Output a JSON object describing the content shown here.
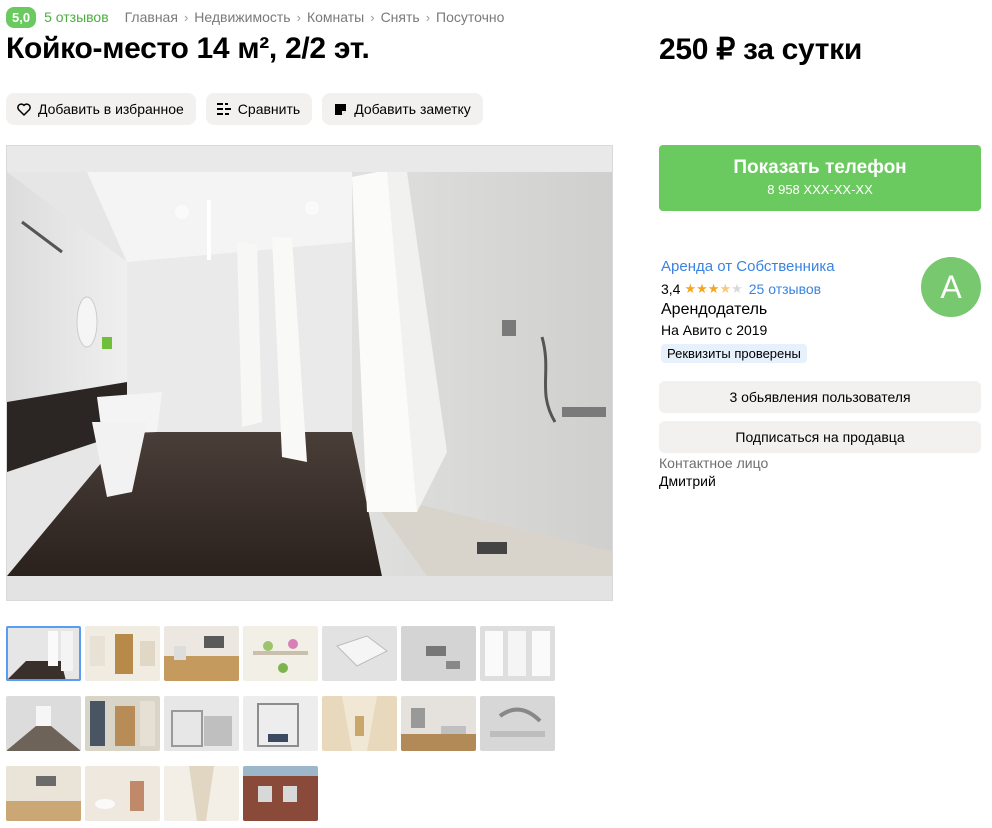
{
  "header": {
    "rating": "5,0",
    "reviews": "5 отзывов",
    "breadcrumbs": [
      "Главная",
      "Недвижимость",
      "Комнаты",
      "Снять",
      "Посуточно"
    ]
  },
  "listing": {
    "title": "Койко-место 14 м², 2/2 эт.",
    "price": "250 ₽ за сутки"
  },
  "actions": {
    "favorite": "Добавить в избранное",
    "compare": "Сравнить",
    "note": "Добавить заметку"
  },
  "phone": {
    "label": "Показать телефон",
    "number": "8 958 XXX-XX-XX"
  },
  "seller": {
    "name": "Аренда от Собственника",
    "rating": "3,4",
    "stars_filled": 3.5,
    "reviews": "25 отзывов",
    "role": "Арендодатель",
    "since": "На Авито с 2019",
    "verified": "Реквизиты проверены",
    "avatar_letter": "А",
    "listings_button": "3 обьявления пользователя",
    "subscribe_button": "Подписаться на продавца",
    "contact_label": "Контактное лицо",
    "contact_name": "Дмитрий"
  },
  "colors": {
    "accent_green": "#6bca5f",
    "link_blue": "#3b83e0",
    "star": "#f5a623"
  },
  "gallery": {
    "thumbnails": [
      {
        "scene": "shower-room"
      },
      {
        "scene": "hallway-door"
      },
      {
        "scene": "kitchen"
      },
      {
        "scene": "wall-shelf"
      },
      {
        "scene": "ceiling-shower"
      },
      {
        "scene": "faucet-top"
      },
      {
        "scene": "shower-curtains"
      },
      {
        "scene": "corridor"
      },
      {
        "scene": "entrance"
      },
      {
        "scene": "bunk-beds"
      },
      {
        "scene": "bunk-beds-2"
      },
      {
        "scene": "long-corridor"
      },
      {
        "scene": "kitchen-sink"
      },
      {
        "scene": "faucet"
      },
      {
        "scene": "kitchen-2"
      },
      {
        "scene": "bathroom-sink"
      },
      {
        "scene": "narrow-corridor"
      },
      {
        "scene": "brick-building"
      }
    ]
  }
}
